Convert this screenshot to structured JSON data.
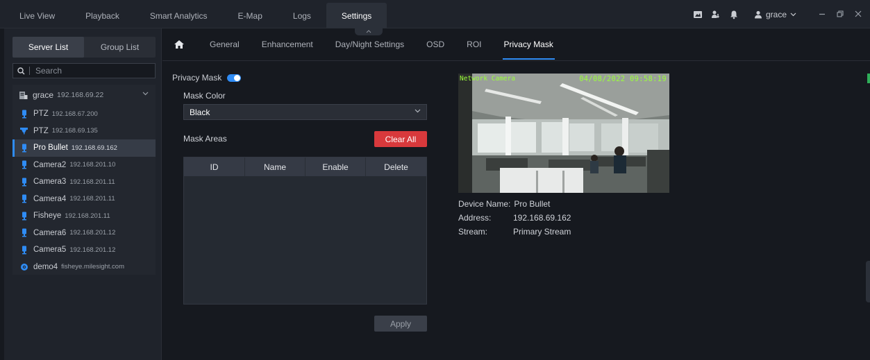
{
  "top_nav": {
    "tabs": [
      "Live View",
      "Playback",
      "Smart Analytics",
      "E-Map",
      "Logs",
      "Settings"
    ],
    "active": "Settings"
  },
  "top_right": {
    "user": "grace"
  },
  "sidebar": {
    "tabs": [
      "Server List",
      "Group List"
    ],
    "active_tab": "Server List",
    "search_placeholder": "Search",
    "server": {
      "name": "grace",
      "ip": "192.168.69.22"
    },
    "devices": [
      {
        "name": "PTZ",
        "ip": "192.168.67.200",
        "icon": "bullet-camera-icon"
      },
      {
        "name": "PTZ",
        "ip": "192.168.69.135",
        "icon": "ptz-camera-icon"
      },
      {
        "name": "Pro Bullet",
        "ip": "192.168.69.162",
        "icon": "bullet-camera-icon",
        "selected": true
      },
      {
        "name": "Camera2",
        "ip": "192.168.201.10",
        "icon": "bullet-camera-icon"
      },
      {
        "name": "Camera3",
        "ip": "192.168.201.11",
        "icon": "bullet-camera-icon"
      },
      {
        "name": "Camera4",
        "ip": "192.168.201.11",
        "icon": "bullet-camera-icon"
      },
      {
        "name": "Fisheye",
        "ip": "192.168.201.11",
        "icon": "bullet-camera-icon"
      },
      {
        "name": "Camera6",
        "ip": "192.168.201.12",
        "icon": "bullet-camera-icon"
      },
      {
        "name": "Camera5",
        "ip": "192.168.201.12",
        "icon": "bullet-camera-icon"
      },
      {
        "name": "demo4",
        "ip": "fisheye.milesight.com",
        "icon": "fisheye-camera-icon"
      }
    ]
  },
  "sub_nav": {
    "tabs": [
      "General",
      "Enhancement",
      "Day/Night Settings",
      "OSD",
      "ROI",
      "Privacy Mask"
    ],
    "active": "Privacy Mask"
  },
  "privacy": {
    "label": "Privacy Mask",
    "enabled": true,
    "mask_color_label": "Mask Color",
    "mask_color_value": "Black",
    "mask_areas_label": "Mask Areas",
    "clear_all": "Clear All",
    "columns": [
      "ID",
      "Name",
      "Enable",
      "Delete"
    ],
    "rows": [],
    "apply": "Apply"
  },
  "preview": {
    "osd_name": "Network Camera",
    "osd_time": "04/08/2022 09:58:19"
  },
  "info": {
    "device_name_label": "Device Name:",
    "device_name": "Pro Bullet",
    "address_label": "Address:",
    "address": "192.168.69.162",
    "stream_label": "Stream:",
    "stream": "Primary Stream"
  },
  "colors": {
    "accent": "#2f8cf5",
    "danger": "#d8393c",
    "osd": "#9bff3a",
    "background": "#16191f",
    "panel": "#1f232b"
  }
}
